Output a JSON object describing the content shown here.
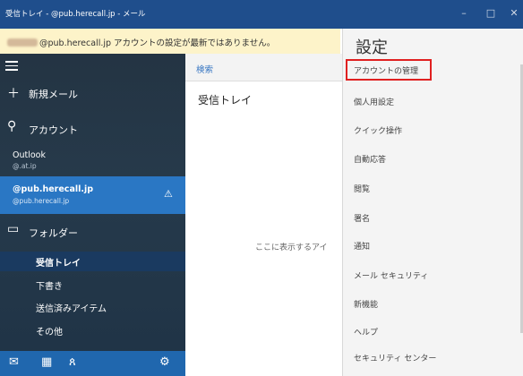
{
  "window": {
    "title": "受信トレイ - @pub.herecall.jp - メール",
    "controls": {
      "minimize": "–",
      "maximize": "□",
      "close": "✕"
    }
  },
  "banner": {
    "message": "@pub.herecall.jp アカウントの設定が最新ではありません。"
  },
  "sidebar": {
    "new_mail": "新規メール",
    "accounts_label": "アカウント",
    "accounts": [
      {
        "name": "Outlook",
        "email": "@.at.ip"
      },
      {
        "name": "@pub.herecall.jp",
        "email": "@pub.herecall.jp",
        "warning": "⚠"
      }
    ],
    "folders_label": "フォルダー",
    "folders": [
      "受信トレイ",
      "下書き",
      "送信済みアイテム",
      "その他"
    ]
  },
  "middle": {
    "search_label": "検索",
    "folder_title": "受信トレイ",
    "empty_message": "ここに表示するアイ"
  },
  "settings": {
    "title": "設定",
    "items": [
      "アカウントの管理",
      "個人用設定",
      "クイック操作",
      "自動応答",
      "閲覧",
      "署名",
      "通知",
      "メール セキュリティ",
      "新機能",
      "ヘルプ",
      "セキュリティ センター"
    ],
    "highlighted": "アカウントの管理"
  },
  "colors": {
    "titlebar": "#1f4e8c",
    "accent": "#2a77c4",
    "highlight": "#e02020"
  },
  "icons": [
    "hamburger-icon",
    "plus-icon",
    "person-icon",
    "warning-icon",
    "folder-icon",
    "mail-icon",
    "calendar-icon",
    "people-icon",
    "gear-icon"
  ]
}
